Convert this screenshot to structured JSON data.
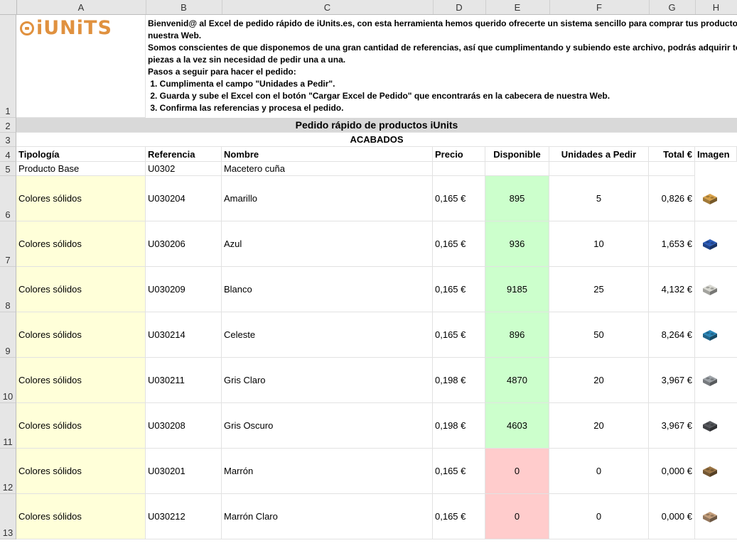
{
  "columns": [
    "A",
    "B",
    "C",
    "D",
    "E",
    "F",
    "G",
    "H"
  ],
  "row_numbers": [
    "1",
    "2",
    "3",
    "4",
    "5",
    "6",
    "7",
    "8",
    "9",
    "10",
    "11",
    "12",
    "13"
  ],
  "brand": {
    "logo_text": "iUNiTS",
    "accent": "#e0913f"
  },
  "intro_lines": [
    "Bienvenid@ al Excel de pedido rápido de iUnits.es, con esta herramienta hemos querido ofrecerte un sistema sencillo para comprar tus productos en",
    "nuestra Web.",
    "Somos conscientes de que disponemos de una gran cantidad de referencias, así que cumplimentando y subiendo este archivo, podrás adquirir todas las",
    "piezas a la vez sin necesidad de pedir una a una.",
    "Pasos a seguir para hacer el pedido:",
    " 1. Cumplimenta el campo \"Unidades a Pedir\".",
    " 2. Guarda y sube el Excel con el botón \"Cargar Excel de Pedido\" que encontrarás en la cabecera de nuestra Web.",
    " 3. Confirma las referencias y procesa el pedido."
  ],
  "title": "Pedido rápido de productos iUnits",
  "section": "ACABADOS",
  "headers": {
    "tipologia": "Tipología",
    "referencia": "Referencia",
    "nombre": "Nombre",
    "precio": "Precio",
    "disponible": "Disponible",
    "unidades": "Unidades a Pedir",
    "total": "Total €",
    "imagen": "Imagen"
  },
  "base_product": {
    "tipologia": "Producto Base",
    "referencia": "U0302",
    "nombre": "Macetero cuña"
  },
  "products": [
    {
      "tipologia": "Colores sólidos",
      "referencia": "U030204",
      "nombre": "Amarillo",
      "precio": "0,165 €",
      "disponible": "895",
      "unidades": "5",
      "total": "0,826 €",
      "stock_status": "ok",
      "color": "#d8a24a"
    },
    {
      "tipologia": "Colores sólidos",
      "referencia": "U030206",
      "nombre": "Azul",
      "precio": "0,165 €",
      "disponible": "936",
      "unidades": "10",
      "total": "1,653 €",
      "stock_status": "ok",
      "color": "#2b5bb8"
    },
    {
      "tipologia": "Colores sólidos",
      "referencia": "U030209",
      "nombre": "Blanco",
      "precio": "0,165 €",
      "disponible": "9185",
      "unidades": "25",
      "total": "4,132 €",
      "stock_status": "ok",
      "color": "#d9d9d2"
    },
    {
      "tipologia": "Colores sólidos",
      "referencia": "U030214",
      "nombre": "Celeste",
      "precio": "0,165 €",
      "disponible": "896",
      "unidades": "50",
      "total": "8,264 €",
      "stock_status": "ok",
      "color": "#2a86b8"
    },
    {
      "tipologia": "Colores sólidos",
      "referencia": "U030211",
      "nombre": "Gris Claro",
      "precio": "0,198 €",
      "disponible": "4870",
      "unidades": "20",
      "total": "3,967 €",
      "stock_status": "ok",
      "color": "#9ea3a8"
    },
    {
      "tipologia": "Colores sólidos",
      "referencia": "U030208",
      "nombre": "Gris Oscuro",
      "precio": "0,198 €",
      "disponible": "4603",
      "unidades": "20",
      "total": "3,967 €",
      "stock_status": "ok",
      "color": "#55575c"
    },
    {
      "tipologia": "Colores sólidos",
      "referencia": "U030201",
      "nombre": "Marrón",
      "precio": "0,165 €",
      "disponible": "0",
      "unidades": "0",
      "total": "0,000 €",
      "stock_status": "empty",
      "color": "#9a7444"
    },
    {
      "tipologia": "Colores sólidos",
      "referencia": "U030212",
      "nombre": "Marrón Claro",
      "precio": "0,165 €",
      "disponible": "0",
      "unidades": "0",
      "total": "0,000 €",
      "stock_status": "empty",
      "color": "#c49e7a"
    }
  ],
  "colors": {
    "tipologia_fill": "#ffffd9",
    "in_stock_fill": "#ccffcc",
    "out_of_stock_fill": "#ffcccc",
    "title_fill": "#d9d9d9"
  }
}
